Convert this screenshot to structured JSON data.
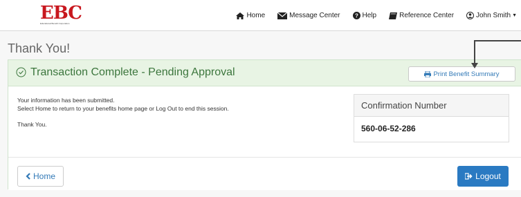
{
  "brand": {
    "logo_text": "EBC",
    "logo_subtitle": "Educational Benefit Corporation",
    "logo_color": "#c8171e"
  },
  "nav": {
    "items": [
      {
        "label": "Home",
        "icon": "home-icon"
      },
      {
        "label": "Message Center",
        "icon": "envelope-icon"
      },
      {
        "label": "Help",
        "icon": "question-circle-icon"
      },
      {
        "label": "Reference Center",
        "icon": "book-icon"
      },
      {
        "label": "John Smith",
        "icon": "user-icon"
      }
    ]
  },
  "page": {
    "title": "Thank You!"
  },
  "panel": {
    "title": "Transaction Complete - Pending Approval",
    "print_button": "Print Benefit Summary",
    "body_lines": [
      "Your information has been submitted.",
      "Select Home to return to your benefits home page or Log Out to end this session.",
      "Thank You."
    ],
    "confirmation": {
      "label": "Confirmation Number",
      "number": "560-06-52-286"
    }
  },
  "footer": {
    "home_button": "Home",
    "logout_button": "Logout"
  },
  "colors": {
    "success_bg": "#e8f4e4",
    "success_text": "#3c763d",
    "primary": "#2a7ac2",
    "link": "#337ab7"
  }
}
